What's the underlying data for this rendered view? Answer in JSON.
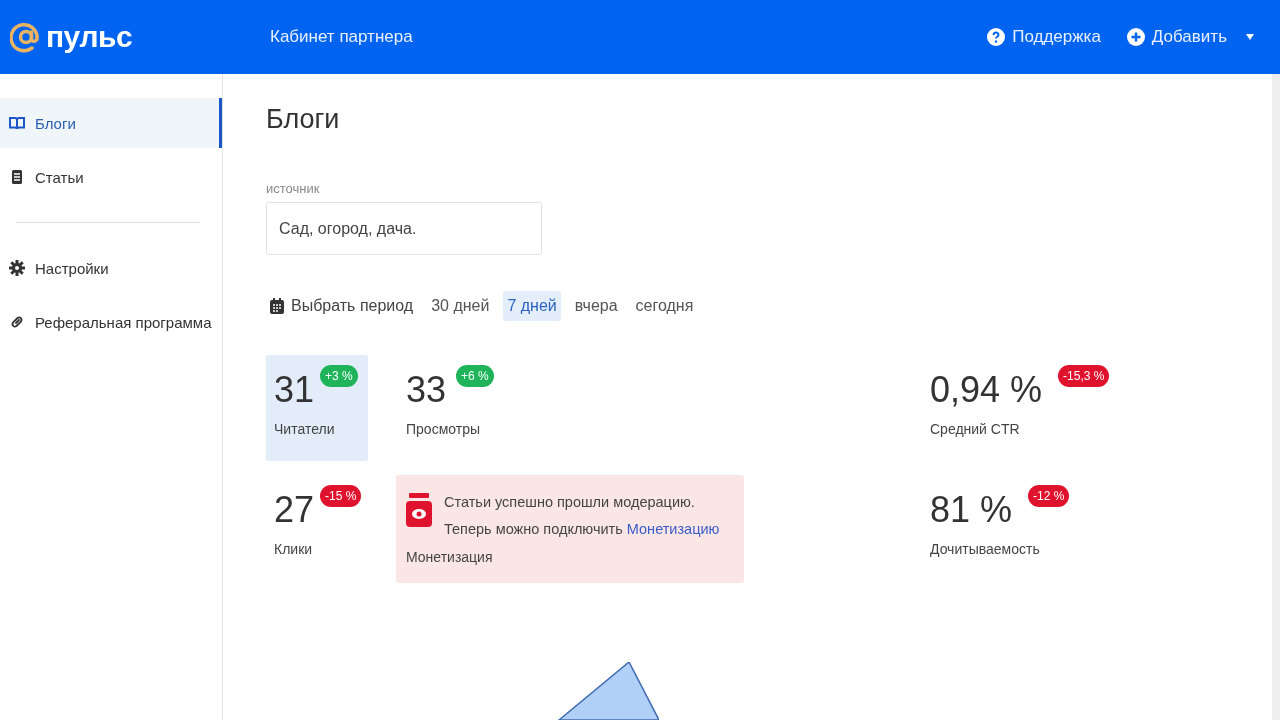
{
  "header": {
    "logo": "пульс",
    "title": "Кабинет партнера",
    "actions": [
      {
        "kind": "help",
        "label": "Поддержка"
      },
      {
        "kind": "add",
        "label": "Добавить"
      }
    ]
  },
  "sidebar": {
    "groups": [
      [
        {
          "label": "Блоги",
          "selected": true
        },
        {
          "label": "Статьи",
          "selected": false
        }
      ],
      [
        {
          "label": "Настройки",
          "selected": false
        },
        {
          "label": "Реферальная программа",
          "selected": false
        }
      ]
    ]
  },
  "page": {
    "title": "Блоги",
    "source": {
      "label": "источник",
      "value": "Сад, огород, дача."
    },
    "period": {
      "picker": "Выбрать период",
      "options": [
        {
          "label": "30 дней",
          "selected": false
        },
        {
          "label": "7 дней",
          "selected": true
        },
        {
          "label": "вчера",
          "selected": false
        },
        {
          "label": "сегодня",
          "selected": false
        }
      ]
    },
    "metrics": [
      {
        "value": "31",
        "label": "Читатели",
        "change": "+3 %",
        "color": "#1fb45a",
        "selected": true
      },
      {
        "value": "33",
        "label": "Просмотры",
        "change": "+6 %",
        "color": "#1fb45a",
        "selected": false
      },
      {
        "value": "0,94 %",
        "label": "Средний CTR",
        "change": "-15,3 %",
        "color": "#e0132f",
        "selected": false
      },
      {
        "value": "27",
        "label": "Клики",
        "change": "-15 %",
        "color": "#e0132f",
        "selected": false
      },
      {
        "value": "81 %",
        "label": "Дочитываемость",
        "change": "-12 %",
        "color": "#e0132f",
        "selected": false
      }
    ],
    "notice": {
      "text": "Статьи успешно прошли модерацию. Теперь можно подключить ",
      "link": "Монетизацию",
      "caption": "Монетизация"
    }
  }
}
